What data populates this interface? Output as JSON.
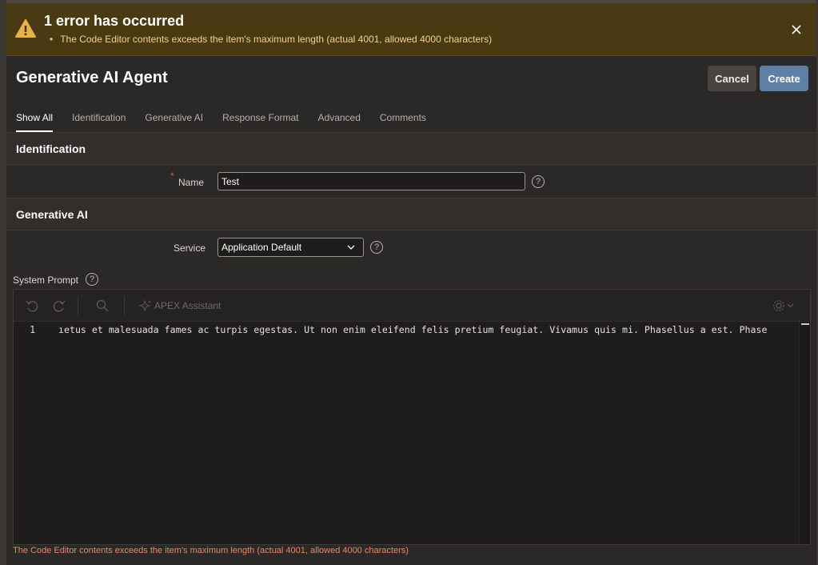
{
  "alert": {
    "title": "1 error has occurred",
    "message": "The Code Editor contents exceeds the item's maximum length (actual 4001, allowed 4000 characters)",
    "icon": "warning-icon",
    "color": "#4a3a14"
  },
  "header": {
    "title": "Generative AI Agent",
    "cancel_label": "Cancel",
    "create_label": "Create"
  },
  "tabs": [
    {
      "label": "Show All",
      "active": true
    },
    {
      "label": "Identification"
    },
    {
      "label": "Generative AI"
    },
    {
      "label": "Response Format"
    },
    {
      "label": "Advanced"
    },
    {
      "label": "Comments"
    }
  ],
  "identification": {
    "section_title": "Identification",
    "name_label": "Name",
    "name_required": "*",
    "name_value": "Test"
  },
  "generative_ai": {
    "section_title": "Generative AI",
    "service_label": "Service",
    "service_value": "Application Default"
  },
  "system_prompt": {
    "label": "System Prompt",
    "assistant_label": "APEX Assistant",
    "line_number": "1",
    "code": "ıetus et malesuada fames ac turpis egestas. Ut non enim eleifend felis pretium feugiat. Vivamus quis mi. Phasellus a est. Phase",
    "error": "The Code Editor contents exceeds the item's maximum length (actual 4001, allowed 4000 characters)"
  },
  "help_symbol": "?",
  "colors": {
    "primary": "#5f80a6",
    "error_text": "#e8876a",
    "required": "#e0564b"
  }
}
